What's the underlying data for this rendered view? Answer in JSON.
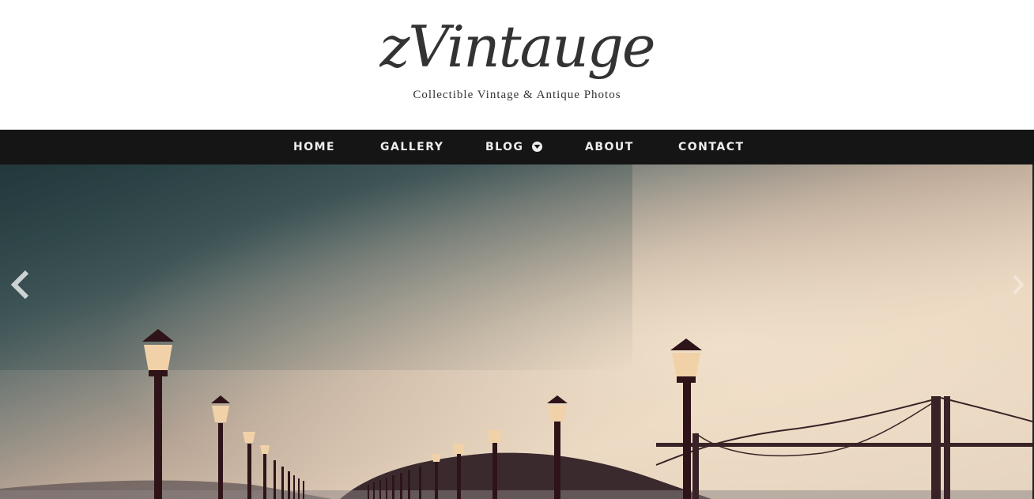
{
  "site": {
    "logo": "zVintauge",
    "tagline": "Collectible Vintage & Antique Photos"
  },
  "nav": {
    "home": "HOME",
    "gallery": "GALLERY",
    "blog": "BLOG",
    "about": "ABOUT",
    "contact": "CONTACT"
  },
  "icons": {
    "blog_dropdown": "chevron-down-circle-icon",
    "slider_prev": "chevron-left-icon",
    "slider_next": "chevron-right-icon"
  },
  "colors": {
    "nav_background": "#151515",
    "nav_text": "#eeeeee",
    "logo_text": "#333333"
  }
}
